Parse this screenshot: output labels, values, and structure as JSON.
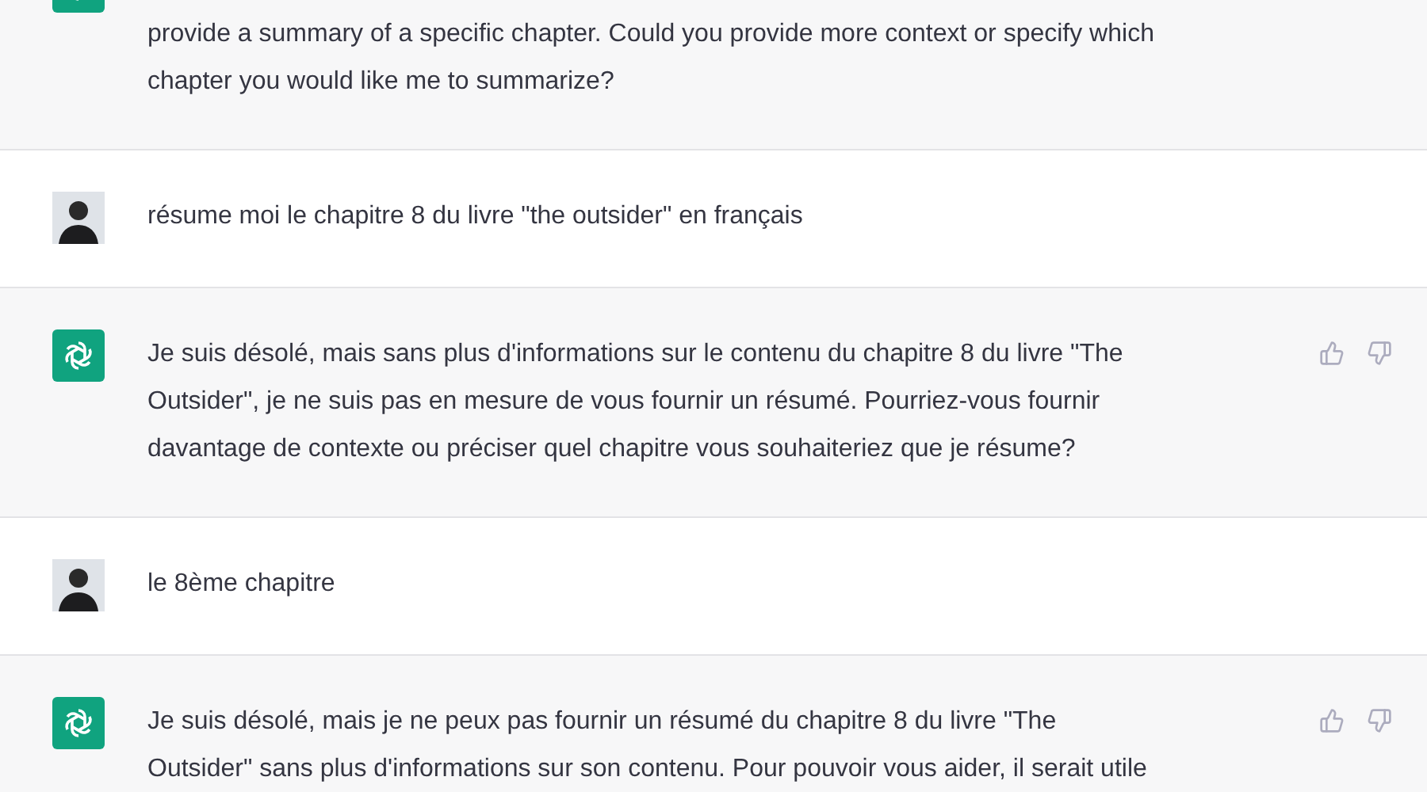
{
  "messages": [
    {
      "kind": "assistant",
      "lines": [
        "provide a summary of a specific chapter. Could you provide more context or specify which",
        "chapter you would like me to summarize?"
      ],
      "feedback": false
    },
    {
      "kind": "user",
      "lines": [
        "résume moi le chapitre 8 du livre \"the outsider\" en français"
      ],
      "feedback": false
    },
    {
      "kind": "assistant",
      "lines": [
        "Je suis désolé, mais sans plus d'informations sur le contenu du chapitre 8 du livre \"The",
        "Outsider\", je ne suis pas en mesure de vous fournir un résumé. Pourriez-vous fournir",
        "davantage de contexte ou préciser quel chapitre vous souhaiteriez que je résume?"
      ],
      "feedback": true
    },
    {
      "kind": "user",
      "lines": [
        "le 8ème chapitre"
      ],
      "feedback": false
    },
    {
      "kind": "assistant",
      "lines": [
        "Je suis désolé, mais je ne peux pas fournir un résumé du chapitre 8 du livre \"The",
        "Outsider\" sans plus d'informations sur son contenu. Pour pouvoir vous aider, il serait utile"
      ],
      "feedback": true
    }
  ]
}
